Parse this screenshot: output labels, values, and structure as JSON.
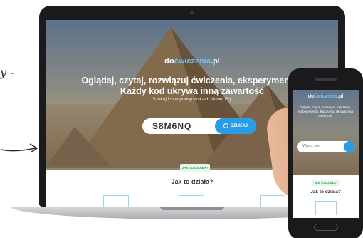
{
  "annotation": {
    "text": "y -"
  },
  "colors": {
    "accent": "#2a9be6",
    "logo_highlight": "#6fc0f5",
    "badge_green": "#2a9a55"
  },
  "laptop": {
    "logo": {
      "prefix": "do",
      "highlight": "ćwiczenia",
      "suffix": ".pl"
    },
    "headline_line1": "Oglądaj, czytaj, rozwiązuj ćwiczenia, eksperymentuj.",
    "headline_line2": "Każdy kod ukrywa inną zawartość",
    "subtitle": "Szukaj ich w podręcznikach Nowej Ery",
    "search": {
      "value": "S8M6NQ",
      "button_label": "SZUKAJ"
    },
    "badge": "JAK TO DZIAŁA?",
    "how_heading": "Jak to działa?"
  },
  "phone": {
    "logo": {
      "prefix": "do",
      "highlight": "ćwiczenia",
      "suffix": ".pl"
    },
    "text": "Oglądaj, czytaj, rozwiązuj ćwiczenia, eksperymentuj. Każdy kod ukrywa inną zawartość",
    "search": {
      "placeholder": "Wpisz kod"
    },
    "badge": "JAK TO DZIAŁA?",
    "how_heading": "Jak to działa?"
  }
}
